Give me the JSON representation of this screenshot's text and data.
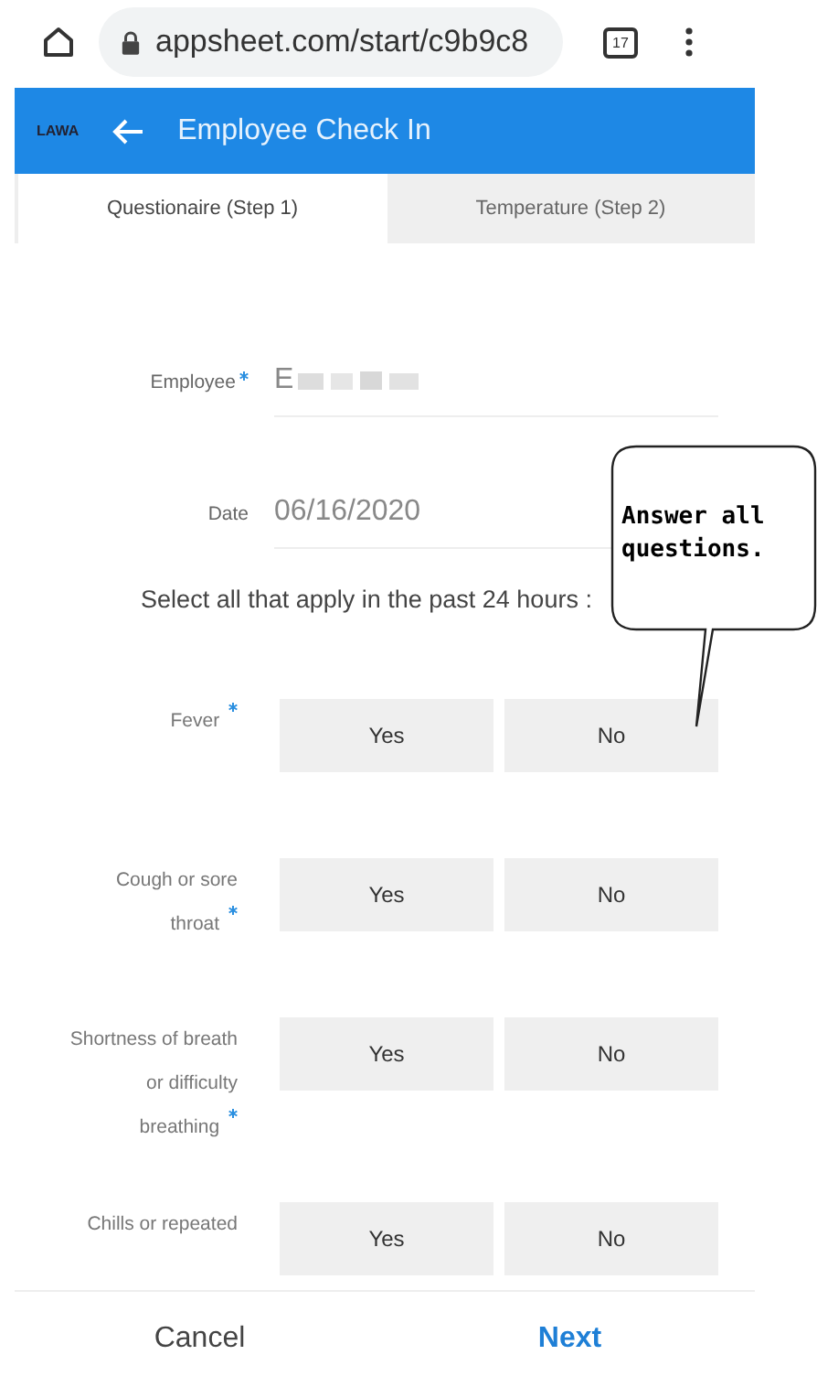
{
  "browser": {
    "url": "appsheet.com/start/c9b9c8",
    "tab_count": "17"
  },
  "app_bar": {
    "logo": "LAWA",
    "title": "Employee Check In"
  },
  "tabs": [
    {
      "label": "Questionaire (Step 1)",
      "selected": true
    },
    {
      "label": "Temperature (Step 2)",
      "selected": false
    }
  ],
  "fields": [
    {
      "label": "Employee",
      "required": true,
      "value": "E",
      "redacted": true
    },
    {
      "label": "Date",
      "required": false,
      "value": "06/16/2020",
      "redacted": false
    }
  ],
  "section_prompt": "Select all that apply in the past 24 hours :",
  "questions": [
    {
      "label": "Fever",
      "required": true,
      "options": [
        {
          "label": "Yes",
          "selected": false
        },
        {
          "label": "No",
          "selected": false
        }
      ]
    },
    {
      "label": "Cough or sore throat",
      "required": true,
      "options": [
        {
          "label": "Yes",
          "selected": false
        },
        {
          "label": "No",
          "selected": false
        }
      ]
    },
    {
      "label": "Shortness of breath or difficulty breathing",
      "required": true,
      "options": [
        {
          "label": "Yes",
          "selected": false
        },
        {
          "label": "No",
          "selected": false
        }
      ]
    },
    {
      "label": "Chills or repeated",
      "required": false,
      "options": [
        {
          "label": "Yes",
          "selected": false
        },
        {
          "label": "No",
          "selected": false
        }
      ]
    }
  ],
  "callout": {
    "text": "Answer all questions."
  },
  "footer": {
    "cancel": "Cancel",
    "next": "Next"
  }
}
